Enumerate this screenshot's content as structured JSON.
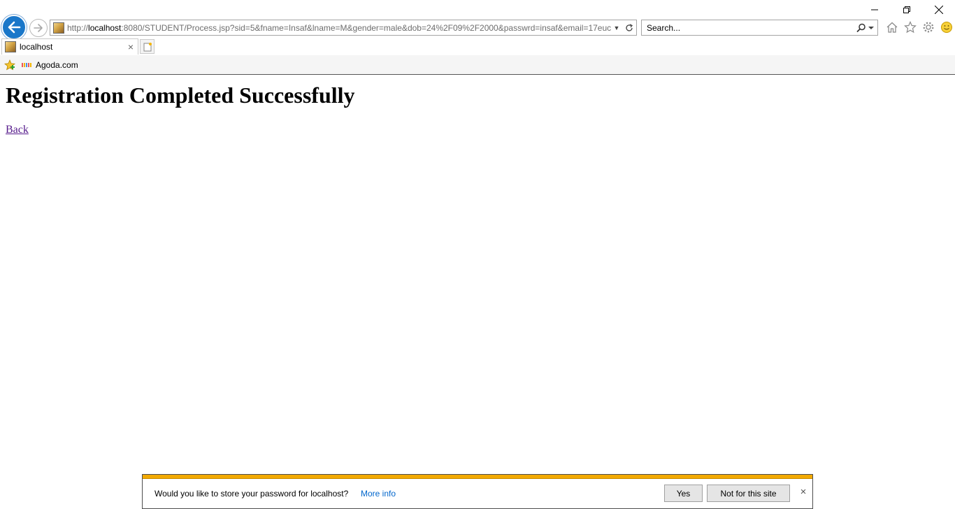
{
  "browser": {
    "address": {
      "prefix": "http://",
      "host": "localhost",
      "rest": ":8080/STUDENT/Process.jsp?sid=5&fname=Insaf&lname=M&gender=male&dob=24%2F09%2F2000&passwrd=insaf&email=17euc"
    },
    "search": {
      "placeholder": "Search..."
    },
    "tab": {
      "label": "localhost"
    },
    "favorites": [
      {
        "label": "Agoda.com"
      }
    ]
  },
  "page": {
    "heading": "Registration Completed Successfully",
    "back_link": "Back"
  },
  "notification": {
    "message": "Would you like to store your password for localhost?",
    "more_info": "More info",
    "yes_label": "Yes",
    "no_label": "Not for this site",
    "accent_color": "#f2a900"
  },
  "colors": {
    "back_button": "#1a77c9",
    "visited_link": "#551a8b",
    "info_link": "#0066cc"
  }
}
